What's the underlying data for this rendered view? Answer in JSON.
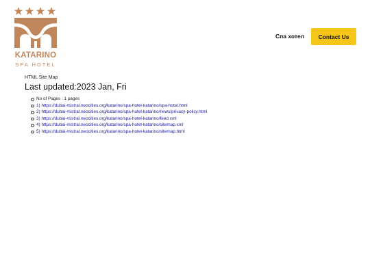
{
  "brand": {
    "name": "KATARINO",
    "subtitle": "SPA HOTEL",
    "stars": "★★★★",
    "color": "#c1875c"
  },
  "nav": {
    "link_label": "Спа хотел",
    "cta_label": "Contact Us",
    "cta_color": "#f5c518"
  },
  "sitemap": {
    "label": "HTML Site Map",
    "updated": "Last updated:2023 Jan, Fri",
    "count_text": "No of Pages : 1 pages",
    "links": [
      "1) https://dubai-mistral.neocities.org/katarino/spa-hotel-katarino/spa-hotel.html",
      "2) https://dubai-mistral.neocities.org/katarino/spa-hotel-katarino/news/privacy-policy.html",
      "3) https://dubai-mistral.neocities.org/katarino/spa-hotel-katarino/feed.xml",
      "4) https://dubai-mistral.neocities.org/katarino/spa-hotel-katarino/sitemap.xml",
      "5) https://dubai-mistral.neocities.org/katarino/spa-hotel-katarino/sitemap.html"
    ]
  }
}
